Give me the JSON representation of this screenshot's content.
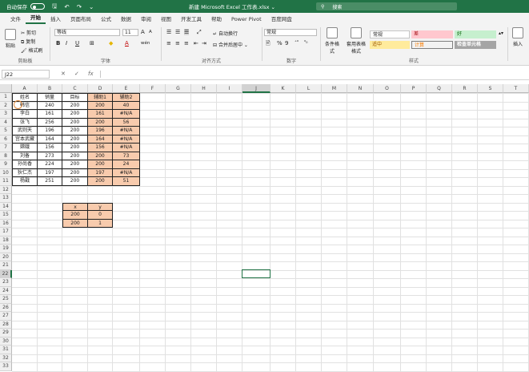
{
  "titlebar": {
    "autosave_label": "自动保存",
    "autosave_state": "关",
    "doc_title": "新建 Microsoft Excel 工作表.xlsx ⌄",
    "search_placeholder": "搜索"
  },
  "tabs": [
    "文件",
    "开始",
    "插入",
    "页面布局",
    "公式",
    "数据",
    "审阅",
    "视图",
    "开发工具",
    "帮助",
    "Power Pivot",
    "百度网盘"
  ],
  "ribbon": {
    "clipboard": {
      "paste": "粘贴",
      "cut": "剪切",
      "copy": "复制",
      "format_painter": "格式刷",
      "label": "剪贴板"
    },
    "font": {
      "name": "等线",
      "size": "11",
      "label": "字体",
      "bold": "B",
      "italic": "I",
      "underline": "U",
      "grow": "A",
      "shrink": "A",
      "fill": "◆",
      "color": "A",
      "wen": "wén"
    },
    "alignment": {
      "wrap": "自动换行",
      "merge": "合并后居中",
      "label": "对齐方式"
    },
    "number": {
      "format": "常规",
      "label": "数字",
      "percent": "%",
      "comma": "9"
    },
    "styles": {
      "conditional": "条件格式",
      "table": "套用表格格式",
      "normal": "常规",
      "bad": "差",
      "good": "好",
      "neutral": "适中",
      "calc": "计算",
      "check": "检查单元格",
      "label": "样式"
    },
    "cells": {
      "insert": "插入"
    }
  },
  "formula": {
    "namebox": "J22",
    "fx": "fx",
    "cancel": "✕",
    "confirm": "✓"
  },
  "columns": [
    "A",
    "B",
    "C",
    "D",
    "E",
    "F",
    "G",
    "H",
    "I",
    "J",
    "K",
    "L",
    "M",
    "N",
    "O",
    "P",
    "Q",
    "R",
    "S",
    "T"
  ],
  "rows": [
    "1",
    "2",
    "3",
    "4",
    "5",
    "6",
    "7",
    "8",
    "9",
    "10",
    "11",
    "12",
    "13",
    "14",
    "15",
    "16",
    "17",
    "18",
    "19",
    "20",
    "21",
    "22",
    "23",
    "24",
    "25",
    "26",
    "27",
    "28",
    "29",
    "30",
    "31",
    "32",
    "33"
  ],
  "main_table": {
    "headers": [
      "姓名",
      "销量",
      "目标",
      "辅助1",
      "辅助2"
    ],
    "data": [
      [
        "韩信",
        "240",
        "200",
        "200",
        "40"
      ],
      [
        "李白",
        "161",
        "200",
        "161",
        "#N/A"
      ],
      [
        "张飞",
        "256",
        "200",
        "200",
        "56"
      ],
      [
        "武则天",
        "196",
        "200",
        "196",
        "#N/A"
      ],
      [
        "宫本武藏",
        "164",
        "200",
        "164",
        "#N/A"
      ],
      [
        "嫦娥",
        "156",
        "200",
        "156",
        "#N/A"
      ],
      [
        "刘备",
        "273",
        "200",
        "200",
        "73"
      ],
      [
        "孙尚香",
        "224",
        "200",
        "200",
        "24"
      ],
      [
        "狄仁杰",
        "197",
        "200",
        "197",
        "#N/A"
      ],
      [
        "杨戬",
        "251",
        "200",
        "200",
        "51"
      ]
    ]
  },
  "xy_table": {
    "headers": [
      "x",
      "y"
    ],
    "data": [
      [
        "200",
        "0"
      ],
      [
        "200",
        "1"
      ]
    ]
  }
}
